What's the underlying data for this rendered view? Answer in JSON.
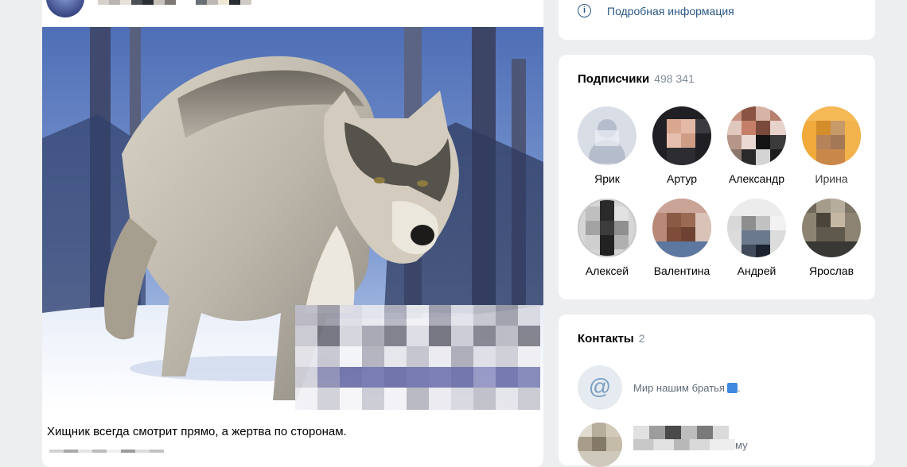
{
  "post": {
    "text": "Хищник всегда смотрит прямо, а жертва по сторонам."
  },
  "info": {
    "link_label": "Подробная информация",
    "icon": "info-icon"
  },
  "followers": {
    "title": "Подписчики",
    "count": "498 341",
    "items": [
      {
        "name": "Ярик"
      },
      {
        "name": "Артур"
      },
      {
        "name": "Александр"
      },
      {
        "name": "Ирина"
      },
      {
        "name": "Алексей"
      },
      {
        "name": "Валентина"
      },
      {
        "name": "Андрей"
      },
      {
        "name": "Ярослав"
      }
    ]
  },
  "contacts": {
    "title": "Контакты",
    "count": "2",
    "items": [
      {
        "label": "Мир нашим братья",
        "icon": "email-at-icon"
      },
      {
        "label_suffix": "му"
      }
    ]
  },
  "colors": {
    "link": "#2a5885",
    "secondary_text": "#818c99",
    "page_background": "#edeef0",
    "card_background": "#ffffff"
  }
}
